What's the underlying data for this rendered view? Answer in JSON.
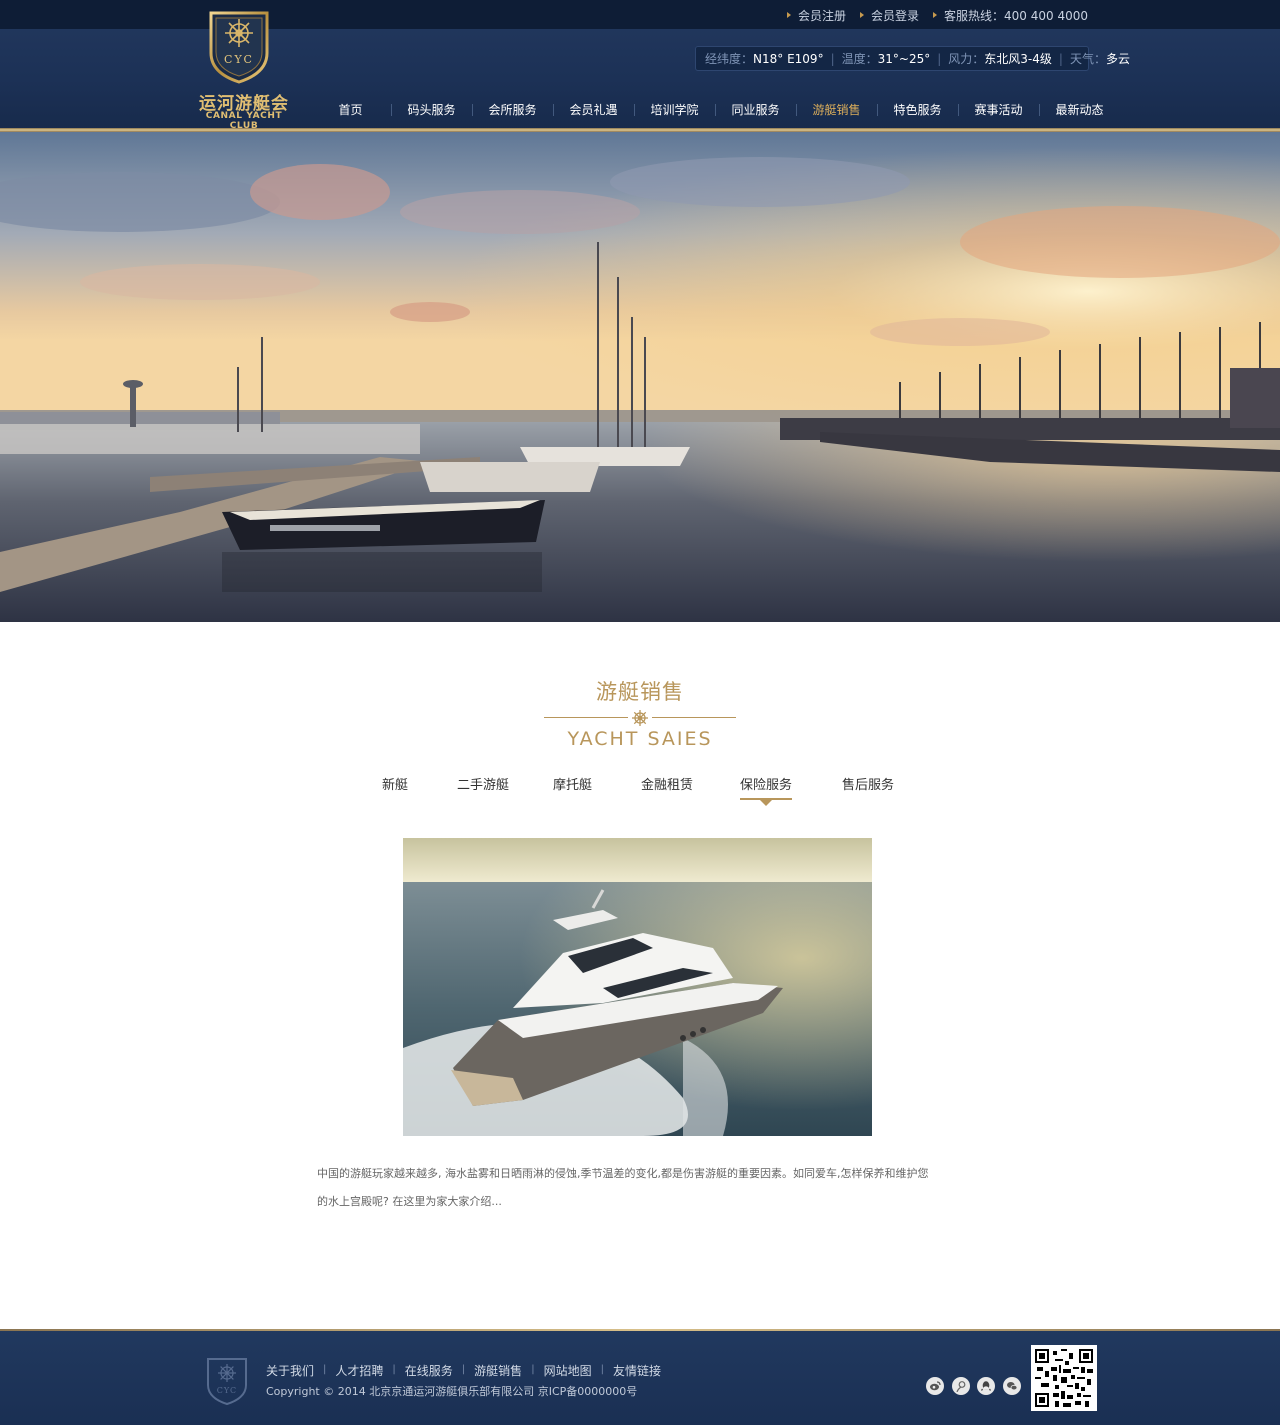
{
  "brand": {
    "monogram": "CYC",
    "name_cn": "运河游艇会",
    "name_en": "CANAL YACHT CLUB"
  },
  "toplinks": {
    "register": "会员注册",
    "login": "会员登录",
    "hotline": "客服热线：400 400 4000"
  },
  "weather": {
    "coord_label": "经纬度：",
    "coord_value": "N18° E109°",
    "temp_label": "温度：",
    "temp_value": "31°~25°",
    "wind_label": "风力：",
    "wind_value": "东北风3-4级",
    "sky_label": "天气：",
    "sky_value": "多云"
  },
  "nav": {
    "items": [
      "首页",
      "码头服务",
      "会所服务",
      "会员礼遇",
      "培训学院",
      "同业服务",
      "游艇销售",
      "特色服务",
      "赛事活动",
      "最新动态"
    ],
    "active_index": 6
  },
  "section": {
    "title_cn": "游艇销售",
    "title_en": "YACHT SAIES"
  },
  "tabs": {
    "items": [
      "新艇",
      "二手游艇",
      "摩托艇",
      "金融租赁",
      "保险服务",
      "售后服务"
    ],
    "active_index": 4
  },
  "content": {
    "description": "中国的游艇玩家越来越多, 海水盐雾和日晒雨淋的侵蚀,季节温差的变化,都是伤害游艇的重要因素。如同爱车,怎样保养和维护您的水上宫殿呢? 在这里为家大家介绍..."
  },
  "footer": {
    "links": [
      "关于我们",
      "人才招聘",
      "在线服务",
      "游艇销售",
      "网站地图",
      "友情链接"
    ],
    "copyright": "Copyright © 2014 北京京通运河游艇俱乐部有限公司  京ICP备0000000号",
    "social_icons": [
      "weibo-icon",
      "tencent-weibo-icon",
      "qq-icon",
      "wechat-icon"
    ]
  },
  "colors": {
    "navy": "#1c3156",
    "gold": "#b8965b",
    "nav_active": "#dcae5b"
  }
}
